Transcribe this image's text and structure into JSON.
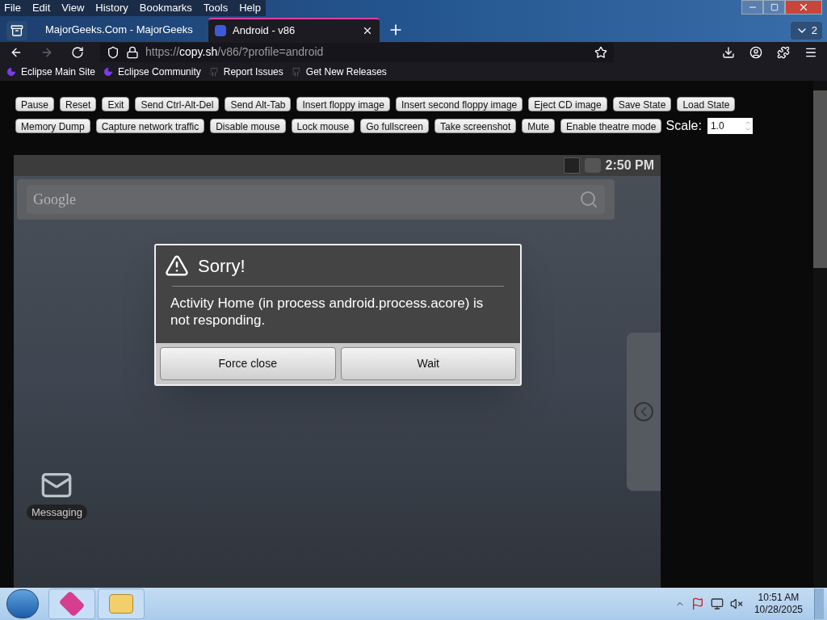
{
  "menu": [
    "File",
    "Edit",
    "View",
    "History",
    "Bookmarks",
    "Tools",
    "Help"
  ],
  "tabs": [
    {
      "title": "MajorGeeks.Com - MajorGeeks",
      "selected": false
    },
    {
      "title": "Android - v86",
      "selected": true
    }
  ],
  "tab_count": "2",
  "url": {
    "scheme": "https://",
    "host": "copy.sh",
    "path": "/v86/?profile=android"
  },
  "bookmarks": [
    {
      "label": "Eclipse Main Site",
      "kind": "eclipse"
    },
    {
      "label": "Eclipse Community",
      "kind": "eclipse"
    },
    {
      "label": "Report Issues",
      "kind": "github"
    },
    {
      "label": "Get New Releases",
      "kind": "github"
    }
  ],
  "controls": [
    [
      "Pause",
      "Reset",
      "Exit",
      "Send Ctrl-Alt-Del",
      "Send Alt-Tab",
      "Insert floppy image",
      "Insert second floppy image",
      "Eject CD image",
      "Save State",
      "Load State"
    ],
    [
      "Memory Dump",
      "Capture network traffic",
      "Disable mouse",
      "Lock mouse",
      "Go fullscreen",
      "Take screenshot",
      "Mute",
      "Enable theatre mode"
    ]
  ],
  "scale": {
    "label": "Scale:",
    "value": "1.0"
  },
  "android": {
    "time": "2:50 PM",
    "search_placeholder": "Google",
    "dialog": {
      "title": "Sorry!",
      "message": "Activity Home (in process android.process.acore) is not responding.",
      "buttons": [
        "Force close",
        "Wait"
      ]
    },
    "desktop_icons": [
      "Messaging"
    ]
  },
  "taskbar": {
    "time": "10:51 AM",
    "date": "10/28/2025"
  }
}
